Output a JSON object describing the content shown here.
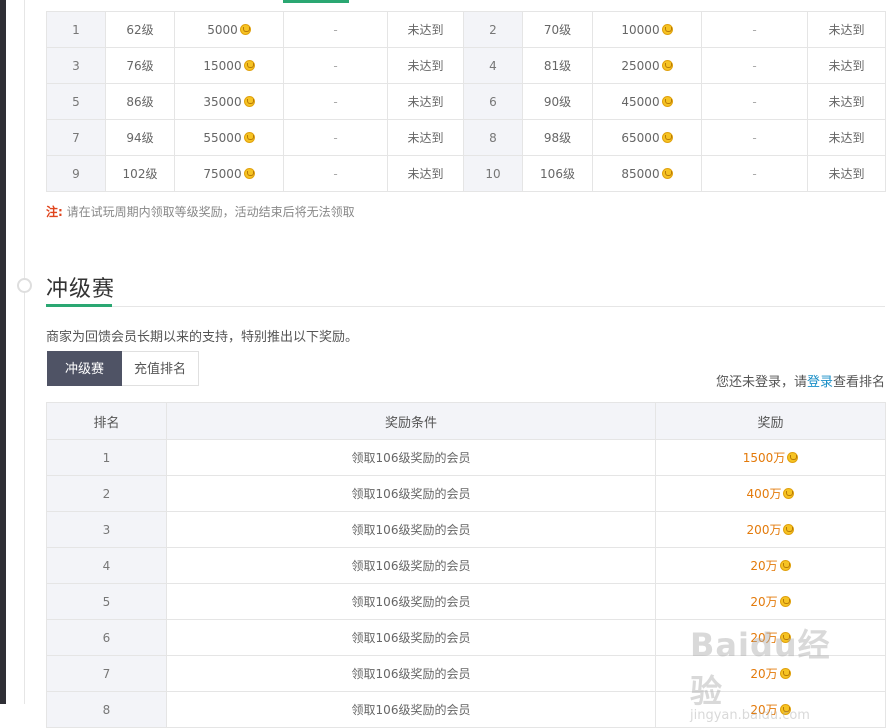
{
  "level_table": {
    "rows": [
      [
        {
          "idx": "1",
          "level": "62级",
          "reward": "5000",
          "status": "-",
          "state": "未达到"
        },
        {
          "idx": "2",
          "level": "70级",
          "reward": "10000",
          "status": "-",
          "state": "未达到"
        }
      ],
      [
        {
          "idx": "3",
          "level": "76级",
          "reward": "15000",
          "status": "-",
          "state": "未达到"
        },
        {
          "idx": "4",
          "level": "81级",
          "reward": "25000",
          "status": "-",
          "state": "未达到"
        }
      ],
      [
        {
          "idx": "5",
          "level": "86级",
          "reward": "35000",
          "status": "-",
          "state": "未达到"
        },
        {
          "idx": "6",
          "level": "90级",
          "reward": "45000",
          "status": "-",
          "state": "未达到"
        }
      ],
      [
        {
          "idx": "7",
          "level": "94级",
          "reward": "55000",
          "status": "-",
          "state": "未达到"
        },
        {
          "idx": "8",
          "level": "98级",
          "reward": "65000",
          "status": "-",
          "state": "未达到"
        }
      ],
      [
        {
          "idx": "9",
          "level": "102级",
          "reward": "75000",
          "status": "-",
          "state": "未达到"
        },
        {
          "idx": "10",
          "level": "106级",
          "reward": "85000",
          "status": "-",
          "state": "未达到"
        }
      ]
    ]
  },
  "note": {
    "label": "注:",
    "text": "请在试玩周期内领取等级奖励，活动结束后将无法领取"
  },
  "section": {
    "title": "冲级赛",
    "description": "商家为回馈会员长期以来的支持，特别推出以下奖励。"
  },
  "tabs": [
    {
      "label": "冲级赛",
      "active": true
    },
    {
      "label": "充值排名",
      "active": false
    }
  ],
  "login": {
    "prefix": "您还未登录，请",
    "link": "登录",
    "suffix": "查看排名"
  },
  "rank_table": {
    "headers": [
      "排名",
      "奖励条件",
      "奖励"
    ],
    "rows": [
      {
        "rank": "1",
        "condition": "领取106级奖励的会员",
        "reward": "1500万"
      },
      {
        "rank": "2",
        "condition": "领取106级奖励的会员",
        "reward": "400万"
      },
      {
        "rank": "3",
        "condition": "领取106级奖励的会员",
        "reward": "200万"
      },
      {
        "rank": "4",
        "condition": "领取106级奖励的会员",
        "reward": "20万"
      },
      {
        "rank": "5",
        "condition": "领取106级奖励的会员",
        "reward": "20万"
      },
      {
        "rank": "6",
        "condition": "领取106级奖励的会员",
        "reward": "20万"
      },
      {
        "rank": "7",
        "condition": "领取106级奖励的会员",
        "reward": "20万"
      },
      {
        "rank": "8",
        "condition": "领取106级奖励的会员",
        "reward": "20万"
      }
    ]
  },
  "watermark": {
    "main": "Baidu经验",
    "sub": "jingyan.baidu.com"
  },
  "colors": {
    "accent_green": "#2aa772",
    "coin_orange": "#e37a0b",
    "tab_active": "#4f5365",
    "link_blue": "#1a8fc7",
    "note_red": "#e0441c"
  }
}
